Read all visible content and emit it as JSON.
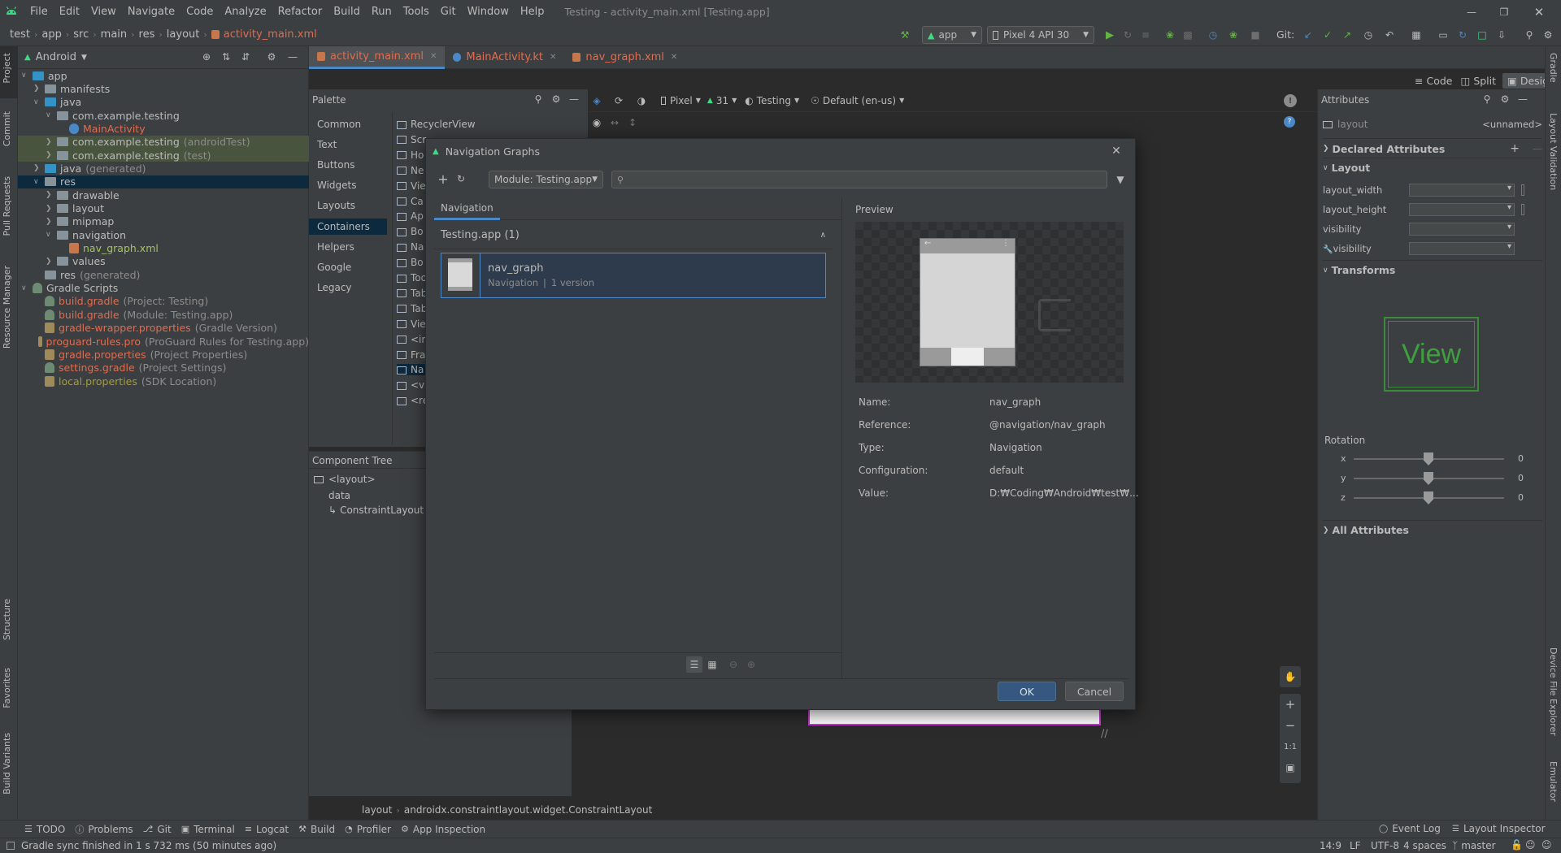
{
  "menu": {
    "items": [
      "File",
      "Edit",
      "View",
      "Navigate",
      "Code",
      "Analyze",
      "Refactor",
      "Build",
      "Run",
      "Tools",
      "Git",
      "Window",
      "Help"
    ],
    "window_title": "Testing - activity_main.xml [Testing.app]"
  },
  "breadcrumb": [
    "test",
    "app",
    "src",
    "main",
    "res",
    "layout",
    "activity_main.xml"
  ],
  "toolbar": {
    "run_config": "app",
    "device": "Pixel 4 API 30",
    "git_label": "Git:"
  },
  "left_strip": [
    "Project",
    "Commit",
    "Pull Requests",
    "Resource Manager",
    "Structure",
    "Favorites",
    "Build Variants"
  ],
  "right_strip": [
    "Gradle",
    "Layout Validation",
    "Device File Explorer",
    "Emulator"
  ],
  "project": {
    "view_mode": "Android",
    "tree": [
      {
        "label": "app",
        "extra": "",
        "level": 0,
        "kind": "folder-blue",
        "open": true,
        "color": "#bbbbbb"
      },
      {
        "label": "manifests",
        "extra": "",
        "level": 1,
        "kind": "folder",
        "open": false,
        "color": "#bbbbbb"
      },
      {
        "label": "java",
        "extra": "",
        "level": 1,
        "kind": "folder-blue",
        "open": true,
        "color": "#bbbbbb"
      },
      {
        "label": "com.example.testing",
        "extra": "",
        "level": 2,
        "kind": "folder",
        "open": true,
        "color": "#bbbbbb"
      },
      {
        "label": "MainActivity",
        "extra": "",
        "level": 3,
        "kind": "kotlin",
        "open": null,
        "color": "#e06c4f"
      },
      {
        "label": "com.example.testing",
        "extra": "(androidTest)",
        "level": 2,
        "kind": "folder",
        "open": false,
        "color": "#bbbbbb",
        "bg": "#49543f"
      },
      {
        "label": "com.example.testing",
        "extra": "(test)",
        "level": 2,
        "kind": "folder",
        "open": false,
        "color": "#bbbbbb",
        "bg": "#49543f"
      },
      {
        "label": "java",
        "extra": "(generated)",
        "level": 1,
        "kind": "folder-blue",
        "open": false,
        "color": "#bbbbbb"
      },
      {
        "label": "res",
        "extra": "",
        "level": 1,
        "kind": "folder",
        "open": true,
        "color": "#bbbbbb",
        "bg": "#0d293e"
      },
      {
        "label": "drawable",
        "extra": "",
        "level": 2,
        "kind": "folder",
        "open": false,
        "color": "#bbbbbb"
      },
      {
        "label": "layout",
        "extra": "",
        "level": 2,
        "kind": "folder",
        "open": false,
        "color": "#bbbbbb"
      },
      {
        "label": "mipmap",
        "extra": "",
        "level": 2,
        "kind": "folder",
        "open": false,
        "color": "#bbbbbb"
      },
      {
        "label": "navigation",
        "extra": "",
        "level": 2,
        "kind": "folder",
        "open": true,
        "color": "#bbbbbb"
      },
      {
        "label": "nav_graph.xml",
        "extra": "",
        "level": 3,
        "kind": "xml",
        "open": null,
        "color": "#a5c25c"
      },
      {
        "label": "values",
        "extra": "",
        "level": 2,
        "kind": "folder",
        "open": false,
        "color": "#bbbbbb"
      },
      {
        "label": "res",
        "extra": "(generated)",
        "level": 1,
        "kind": "folder",
        "open": null,
        "color": "#bbbbbb"
      },
      {
        "label": "Gradle Scripts",
        "extra": "",
        "level": 0,
        "kind": "gradle",
        "open": true,
        "color": "#bbbbbb"
      },
      {
        "label": "build.gradle",
        "extra": "(Project: Testing)",
        "level": 1,
        "kind": "gradle",
        "open": null,
        "color": "#e06c4f"
      },
      {
        "label": "build.gradle",
        "extra": "(Module: Testing.app)",
        "level": 1,
        "kind": "gradle",
        "open": null,
        "color": "#e06c4f"
      },
      {
        "label": "gradle-wrapper.properties",
        "extra": "(Gradle Version)",
        "level": 1,
        "kind": "props",
        "open": null,
        "color": "#e06c4f"
      },
      {
        "label": "proguard-rules.pro",
        "extra": "(ProGuard Rules for Testing.app)",
        "level": 1,
        "kind": "props",
        "open": null,
        "color": "#e06c4f"
      },
      {
        "label": "gradle.properties",
        "extra": "(Project Properties)",
        "level": 1,
        "kind": "props",
        "open": null,
        "color": "#e06c4f"
      },
      {
        "label": "settings.gradle",
        "extra": "(Project Settings)",
        "level": 1,
        "kind": "gradle",
        "open": null,
        "color": "#e06c4f"
      },
      {
        "label": "local.properties",
        "extra": "(SDK Location)",
        "level": 1,
        "kind": "props",
        "open": null,
        "color": "#a59d2f"
      }
    ]
  },
  "editor_tabs": [
    {
      "label": "activity_main.xml",
      "color": "#e06c4f",
      "active": true
    },
    {
      "label": "MainActivity.kt",
      "color": "#e06c4f",
      "active": false
    },
    {
      "label": "nav_graph.xml",
      "color": "#e06c4f",
      "active": false
    }
  ],
  "view_modes": {
    "code": "Code",
    "split": "Split",
    "design": "Design"
  },
  "design_toolbar": {
    "device": "Pixel",
    "api": "31",
    "theme": "Testing",
    "locale": "Default (en-us)"
  },
  "palette": {
    "title": "Palette",
    "categories": [
      "Common",
      "Text",
      "Buttons",
      "Widgets",
      "Layouts",
      "Containers",
      "Helpers",
      "Google",
      "Legacy"
    ],
    "selected_category": "Containers",
    "items": [
      "RecyclerView",
      "Scr",
      "Ho",
      "Ne",
      "Vie",
      "Ca",
      "Ap",
      "Bo",
      "Na",
      "Bo",
      "Too",
      "Tab",
      "Tab",
      "Vie",
      "<ir",
      "Fra",
      "Na",
      "<v",
      "<re"
    ]
  },
  "component_tree": {
    "title": "Component Tree",
    "items": [
      {
        "label": "<layout>",
        "level": 0
      },
      {
        "label": "data",
        "level": 1
      },
      {
        "label": "ConstraintLayout",
        "level": 1
      }
    ]
  },
  "attributes": {
    "title": "Attributes",
    "component": "layout",
    "id_value": "<unnamed>",
    "declared": "Declared Attributes",
    "layout_section": "Layout",
    "rows": [
      "layout_width",
      "layout_height",
      "visibility",
      "visibility"
    ],
    "transforms": "Transforms",
    "view_label": "View",
    "rotation": "Rotation",
    "axes": [
      {
        "axis": "x",
        "value": "0"
      },
      {
        "axis": "y",
        "value": "0"
      },
      {
        "axis": "z",
        "value": "0"
      }
    ],
    "all": "All Attributes"
  },
  "dialog": {
    "title": "Navigation Graphs",
    "module": "Module: Testing.app",
    "tab": "Navigation",
    "group": "Testing.app (1)",
    "item_name": "nav_graph",
    "item_type": "Navigation",
    "item_version": "1 version",
    "preview_label": "Preview",
    "props": [
      {
        "key": "Name:",
        "value": "nav_graph"
      },
      {
        "key": "Reference:",
        "value": "@navigation/nav_graph"
      },
      {
        "key": "Type:",
        "value": "Navigation"
      },
      {
        "key": "Configuration:",
        "value": "default"
      },
      {
        "key": "Value:",
        "value": "D:₩Coding₩Android₩test₩..."
      }
    ],
    "ok": "OK",
    "cancel": "Cancel"
  },
  "canvas_breadcrumb": [
    "layout",
    "androidx.constraintlayout.widget.ConstraintLayout"
  ],
  "zoom_one": "1:1",
  "bottom_tools": [
    "TODO",
    "Problems",
    "Git",
    "Terminal",
    "Logcat",
    "Build",
    "Profiler",
    "App Inspection"
  ],
  "bottom_right_tools": [
    "Event Log",
    "Layout Inspector"
  ],
  "status": {
    "message": "Gradle sync finished in 1 s 732 ms (50 minutes ago)",
    "position": "14:9",
    "line_sep": "LF",
    "encoding": "UTF-8",
    "indent": "4 spaces",
    "branch": "master"
  },
  "colors": {
    "accent": "#4a88c7",
    "android_green": "#3ddc84",
    "selection": "#0d293e",
    "test_bg": "#49543f"
  }
}
